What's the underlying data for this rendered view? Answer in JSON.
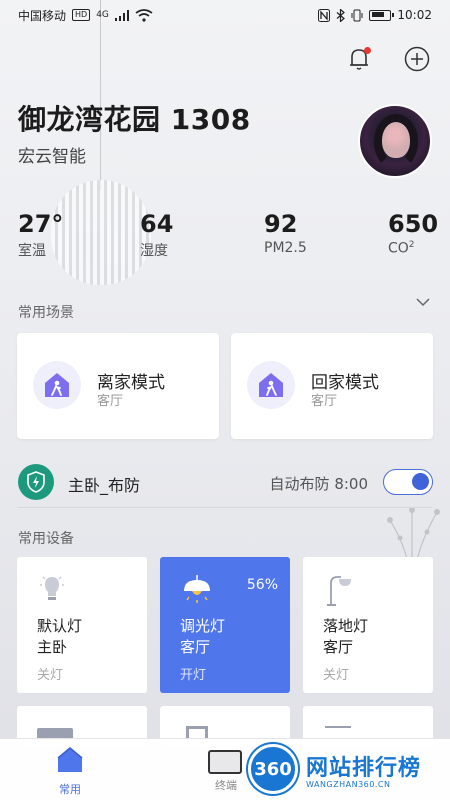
{
  "status_bar": {
    "carrier": "中国移动",
    "hd": "HD",
    "network": "4G",
    "time": "10:02"
  },
  "header": {
    "home_name": "御龙湾花园 1308",
    "brand": "宏云智能"
  },
  "stats": [
    {
      "value": "27°",
      "label": "室温"
    },
    {
      "value": "64",
      "label": "湿度"
    },
    {
      "value": "92",
      "label": "PM2.5"
    },
    {
      "value": "650",
      "label": "CO",
      "sup": "2"
    }
  ],
  "scenes": {
    "title": "常用场景",
    "items": [
      {
        "name": "离家模式",
        "room": "客厅"
      },
      {
        "name": "回家模式",
        "room": "客厅"
      }
    ]
  },
  "security": {
    "name": "主卧_布防",
    "auto_label": "自动布防 8:00",
    "enabled": true
  },
  "devices": {
    "title": "常用设备",
    "items": [
      {
        "name": "默认灯",
        "room": "主卧",
        "state": "关灯",
        "on": false
      },
      {
        "name": "调光灯",
        "room": "客厅",
        "state": "开灯",
        "on": true,
        "level": "56%"
      },
      {
        "name": "落地灯",
        "room": "客厅",
        "state": "关灯",
        "on": false
      }
    ]
  },
  "tabbar": {
    "items": [
      {
        "label": "常用",
        "active": true
      },
      {
        "label": "终端",
        "active": false
      }
    ]
  },
  "watermark": {
    "logo": "360",
    "cn": "网站排行榜",
    "en": "WANGZHAN360.CN"
  },
  "colors": {
    "accent": "#4f76ea",
    "shield": "#1d9a7d",
    "badge": "#e53935"
  }
}
